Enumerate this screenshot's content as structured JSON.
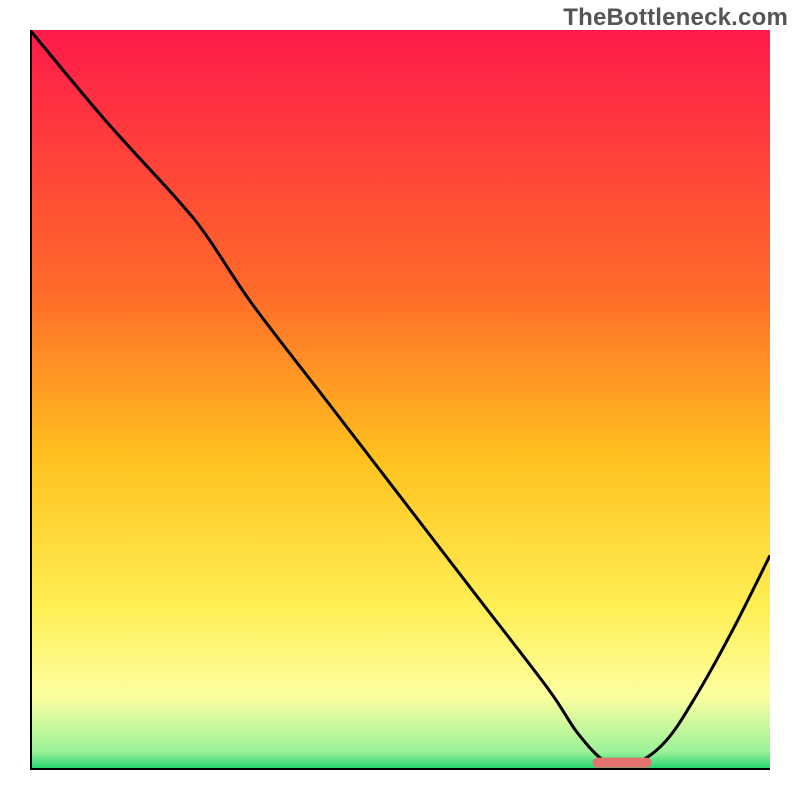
{
  "watermark": "TheBottleneck.com",
  "colors": {
    "gradient_top": "#ff1a4a",
    "gradient_mid1": "#ff6a2a",
    "gradient_mid2": "#ffc21f",
    "gradient_mid3": "#ffef55",
    "gradient_mid4": "#fdffa0",
    "gradient_bottom": "#18d36b",
    "curve": "#000000",
    "axis": "#000000",
    "marker": "#e5716e"
  },
  "chart_data": {
    "type": "line",
    "title": "",
    "xlabel": "",
    "ylabel": "",
    "xlim": [
      0,
      100
    ],
    "ylim": [
      0,
      100
    ],
    "series": [
      {
        "name": "bottleneck-curve",
        "x": [
          0,
          10,
          20,
          24,
          30,
          40,
          50,
          60,
          70,
          74,
          78,
          82,
          86,
          90,
          95,
          100
        ],
        "y": [
          100,
          88,
          77,
          72,
          63,
          50,
          37,
          24,
          11,
          5,
          1,
          1,
          4,
          10,
          19,
          29
        ]
      }
    ],
    "annotations": [
      {
        "name": "optimal-marker",
        "type": "hbar",
        "x0": 76,
        "x1": 84,
        "y": 1.0
      }
    ],
    "background": {
      "type": "vertical-gradient",
      "stops": [
        {
          "pos": 0.0,
          "color": "#ff1a4a"
        },
        {
          "pos": 0.35,
          "color": "#ff6a2a"
        },
        {
          "pos": 0.58,
          "color": "#ffc21f"
        },
        {
          "pos": 0.78,
          "color": "#ffef55"
        },
        {
          "pos": 0.9,
          "color": "#fdffa0"
        },
        {
          "pos": 0.975,
          "color": "#9cf29a"
        },
        {
          "pos": 1.0,
          "color": "#18d36b"
        }
      ]
    }
  }
}
